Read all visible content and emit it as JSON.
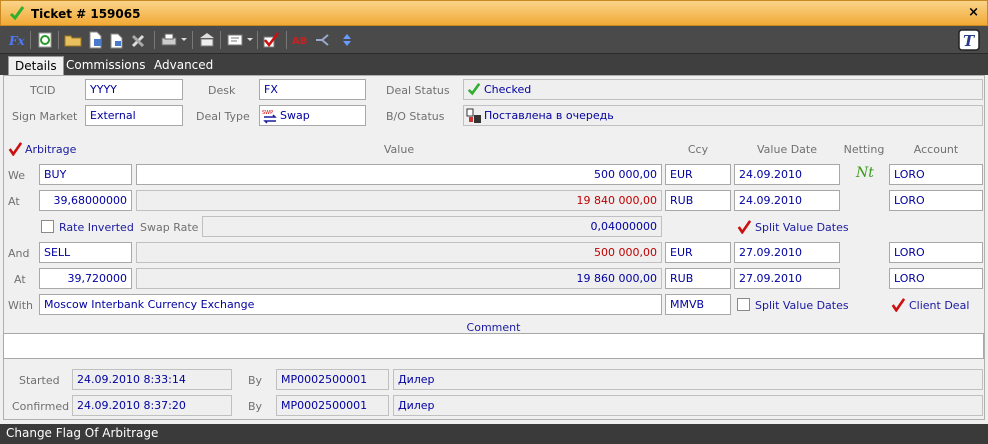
{
  "window": {
    "title": "Ticket # 159065",
    "close": "×"
  },
  "tabs": [
    "Details",
    "Commissions",
    "Advanced"
  ],
  "header": {
    "tcid_label": "TCID",
    "tcid_value": "YYYY",
    "desk_label": "Desk",
    "desk_value": "FX",
    "deal_status_label": "Deal Status",
    "deal_status_value": "Checked",
    "sign_market_label": "Sign Market",
    "sign_market_value": "External",
    "deal_type_label": "Deal Type",
    "deal_type_value": "Swap",
    "bo_status_label": "B/O Status",
    "bo_status_value": "Поставлена в очередь"
  },
  "columns": {
    "arbitrage": "Arbitrage",
    "value": "Value",
    "ccy": "Ccy",
    "value_date": "Value Date",
    "netting": "Netting",
    "account": "Account"
  },
  "leg1": {
    "we_label": "We",
    "direction": "BUY",
    "amount": "500 000,00",
    "ccy": "EUR",
    "value_date": "24.09.2010",
    "netting": "Nt",
    "account": "LORO",
    "at_label": "At",
    "rate": "39,68000000",
    "counter_amount": "19 840 000,00",
    "counter_ccy": "RUB",
    "counter_date": "24.09.2010",
    "counter_account": "LORO"
  },
  "swap": {
    "rate_inverted": "Rate Inverted",
    "swap_rate_label": "Swap Rate",
    "swap_rate": "0,04000000",
    "split_value_dates": "Split Value Dates"
  },
  "leg2": {
    "and_label": "And",
    "direction": "SELL",
    "amount": "500 000,00",
    "ccy": "EUR",
    "value_date": "27.09.2010",
    "account": "LORO",
    "at_label": "At",
    "rate": "39,720000",
    "counter_amount": "19 860 000,00",
    "counter_ccy": "RUB",
    "counter_date": "27.09.2010",
    "counter_account": "LORO"
  },
  "with": {
    "label": "With",
    "counterparty": "Moscow Interbank Currency Exchange",
    "code": "MMVB",
    "split_value_dates": "Split Value Dates",
    "client_deal": "Client Deal"
  },
  "comment": {
    "label": "Comment",
    "value": ""
  },
  "audit": {
    "started_label": "Started",
    "started_time": "24.09.2010 8:33:14",
    "started_by_label": "By",
    "started_by": "MP0002500001",
    "started_role": "Дилер",
    "confirmed_label": "Confirmed",
    "confirmed_time": "24.09.2010 8:37:20",
    "confirmed_by_label": "By",
    "confirmed_by": "MP0002500001",
    "confirmed_role": "Дилер"
  },
  "status_bar": "Change Flag Of Arbitrage",
  "colors": {
    "title_bar": "#f2a935",
    "toolbar": "#4a4a4a",
    "value_blue": "#0000a0",
    "value_red": "#c00000",
    "check_green": "#2fae2f",
    "check_red": "#cc1010"
  }
}
